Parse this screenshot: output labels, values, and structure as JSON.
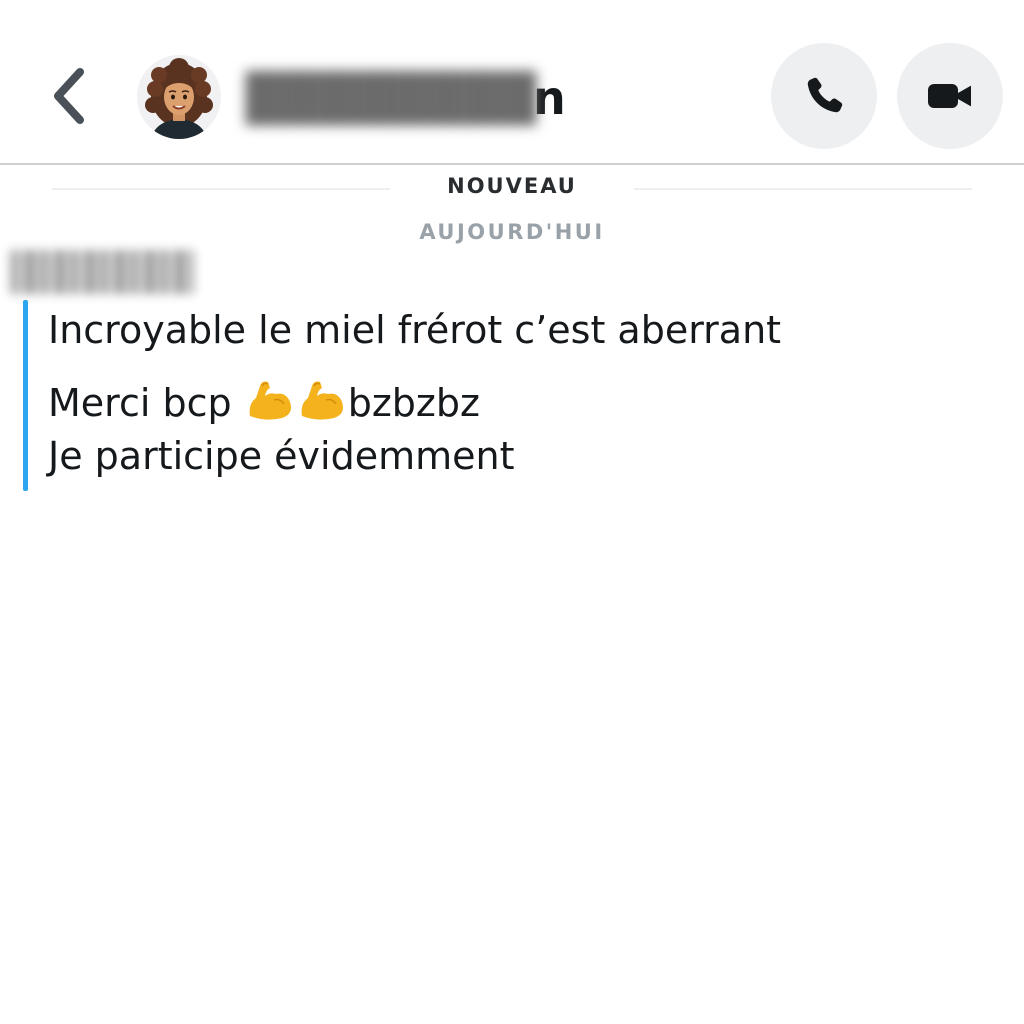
{
  "header": {
    "contact_name_hidden": "",
    "contact_name_visible_tail": "n",
    "back_icon": "chevron-left-icon",
    "call_icon": "phone-icon",
    "video_icon": "video-camera-icon"
  },
  "chat": {
    "new_separator": "NOUVEAU",
    "date_separator": "AUJOURD'HUI",
    "message": {
      "sender": "",
      "accent_color": "#2ea5f0",
      "line1": "Incroyable le miel frérot c’est aberrant",
      "line2_text": "Merci bcp ",
      "line2_emoji": "flexed-biceps-icon",
      "line2_suffix": "bzbzbz",
      "line3": "Je participe évidemment"
    }
  }
}
